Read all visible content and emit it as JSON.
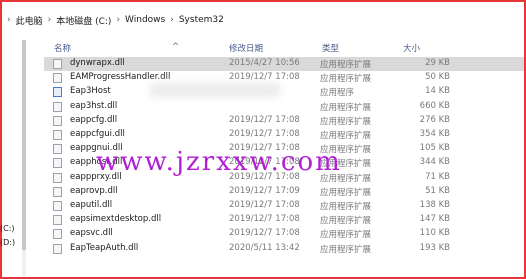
{
  "breadcrumb": [
    "此电脑",
    "本地磁盘 (C:)",
    "Windows",
    "System32"
  ],
  "header": {
    "name": "名称",
    "date": "修改日期",
    "type": "类型",
    "size": "大小"
  },
  "sidebar": {
    "items": [
      "(C:)",
      "(D:)"
    ]
  },
  "files": [
    {
      "name": "dynwrapx.dll",
      "date": "2015/4/27 10:56",
      "type": "应用程序扩展",
      "size": "29 KB",
      "icon": "dll-file-icon",
      "selected": true
    },
    {
      "name": "EAMProgressHandler.dll",
      "date": "2019/12/7 17:08",
      "type": "应用程序扩展",
      "size": "50 KB",
      "icon": "dll-file-icon",
      "selected": false
    },
    {
      "name": "Eap3Host",
      "date": "",
      "type": "应用程序",
      "size": "14 KB",
      "icon": "application-icon",
      "selected": false
    },
    {
      "name": "eap3hst.dll",
      "date": "",
      "type": "应用程序扩展",
      "size": "660 KB",
      "icon": "dll-file-icon",
      "selected": false
    },
    {
      "name": "eappcfg.dll",
      "date": "2019/12/7 17:08",
      "type": "应用程序扩展",
      "size": "276 KB",
      "icon": "dll-file-icon",
      "selected": false
    },
    {
      "name": "eappcfgui.dll",
      "date": "2019/12/7 17:08",
      "type": "应用程序扩展",
      "size": "354 KB",
      "icon": "dll-file-icon",
      "selected": false
    },
    {
      "name": "eappgnui.dll",
      "date": "2019/12/7 17:08",
      "type": "应用程序扩展",
      "size": "105 KB",
      "icon": "dll-file-icon",
      "selected": false
    },
    {
      "name": "eapphost.dll",
      "date": "2019/12/7 17:08",
      "type": "应用程序扩展",
      "size": "344 KB",
      "icon": "dll-file-icon",
      "selected": false
    },
    {
      "name": "eappprxy.dll",
      "date": "2019/12/7 17:08",
      "type": "应用程序扩展",
      "size": "71 KB",
      "icon": "dll-file-icon",
      "selected": false
    },
    {
      "name": "eaprovp.dll",
      "date": "2019/12/7 17:09",
      "type": "应用程序扩展",
      "size": "51 KB",
      "icon": "dll-file-icon",
      "selected": false
    },
    {
      "name": "eaputil.dll",
      "date": "2019/12/7 17:08",
      "type": "应用程序扩展",
      "size": "138 KB",
      "icon": "dll-file-icon",
      "selected": false
    },
    {
      "name": "eapsimextdesktop.dll",
      "date": "2019/12/7 17:08",
      "type": "应用程序扩展",
      "size": "147 KB",
      "icon": "dll-file-icon",
      "selected": false
    },
    {
      "name": "eapsvc.dll",
      "date": "2019/12/7 17:08",
      "type": "应用程序扩展",
      "size": "110 KB",
      "icon": "dll-file-icon",
      "selected": false
    },
    {
      "name": "EapTeapAuth.dll",
      "date": "2020/5/11 13:42",
      "type": "应用程序扩展",
      "size": "193 KB",
      "icon": "dll-file-icon",
      "selected": false
    }
  ],
  "watermark": "www.jzrxxw.com",
  "colors": {
    "frame": "#e8353a",
    "watermark": "#b01fd4",
    "selected_row": "#d9d9d9"
  }
}
